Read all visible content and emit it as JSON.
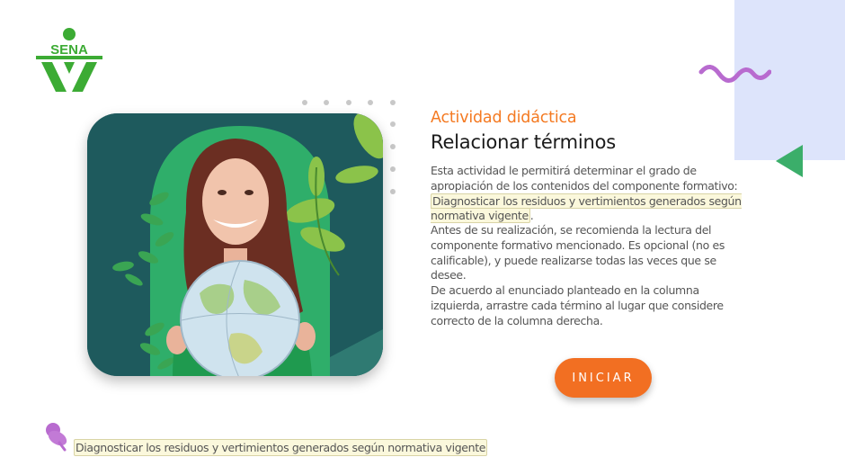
{
  "logo": {
    "text": "SENA",
    "icon": "sena-logo-icon",
    "color": "#3cab34"
  },
  "activity": {
    "kicker": "Actividad didáctica",
    "title": "Relacionar términos",
    "p1_before": "Esta actividad le permitirá determinar el grado de apropiación de los contenidos del componente formativo: ",
    "p1_link": "Diagnosticar los residuos y vertimientos generados según normativa vigente",
    "p1_after": ".",
    "p2": "Antes de su realización, se recomienda la lectura del componente formativo mencionado.  Es opcional (no es calificable), y puede realizarse todas las veces que se desee.",
    "p3": "De acuerdo al enunciado planteado en la columna izquierda, arrastre cada término al lugar que considere correcto de la columna derecha."
  },
  "start_button": {
    "label": "INICIAR"
  },
  "footer": {
    "icon": "pushpin-icon",
    "link_text": "Diagnosticar los residuos y vertimientos generados según normativa vigente"
  },
  "colors": {
    "accent_orange": "#f26f22",
    "panel_blue": "#dde4fb",
    "card_teal": "#1e5a5d",
    "arrow_green": "#3bae6a",
    "wave_purple": "#b86bcf",
    "highlight": "#fbf8dc"
  }
}
